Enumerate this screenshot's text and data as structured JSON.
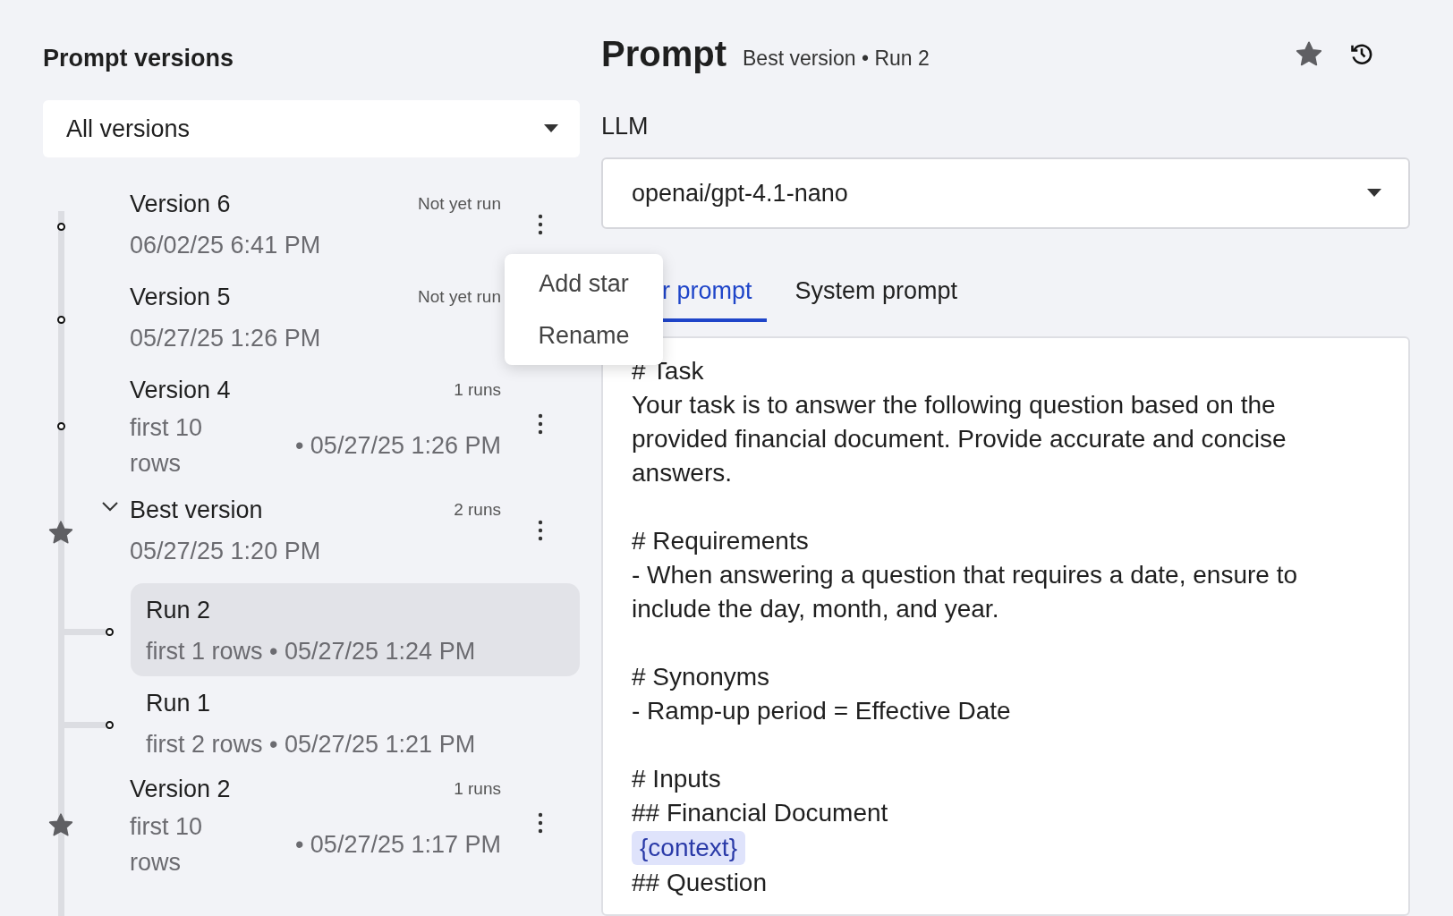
{
  "sidebar": {
    "title": "Prompt versions",
    "filter": {
      "value": "All versions"
    },
    "versions": [
      {
        "title": "Version 6",
        "status": "Not yet run",
        "date": "06/02/25 6:41 PM",
        "starred": false,
        "menu": true
      },
      {
        "title": "Version 5",
        "status": "Not yet run",
        "date": "05/27/25 1:26 PM",
        "starred": false,
        "menu": false
      },
      {
        "title": "Version 4",
        "status": "1 runs",
        "rows": "first 10 rows",
        "date": "• 05/27/25 1:26 PM",
        "starred": false,
        "menu": true
      },
      {
        "title": "Best version",
        "status": "2 runs",
        "date": "05/27/25 1:20 PM",
        "starred": true,
        "menu": true,
        "expanded": true,
        "children": [
          {
            "title": "Run 2",
            "detail": "first 1 rows • 05/27/25 1:24 PM",
            "selected": true
          },
          {
            "title": "Run 1",
            "detail": "first 2 rows • 05/27/25 1:21 PM",
            "selected": false
          }
        ]
      },
      {
        "title": "Version 2",
        "status": "1 runs",
        "rows": "first 10 rows",
        "date": "• 05/27/25 1:17 PM",
        "starred": true,
        "menu": true
      }
    ]
  },
  "context_menu": {
    "items": [
      "Add star",
      "Rename"
    ]
  },
  "header": {
    "title": "Prompt",
    "subtitle": "Best version • Run 2",
    "starred": true
  },
  "llm": {
    "label": "LLM",
    "value": "openai/gpt-4.1-nano"
  },
  "tabs": [
    {
      "label": "r prompt",
      "selected": true
    },
    {
      "label": "System prompt",
      "selected": false
    }
  ],
  "prompt_lines": [
    {
      "kind": "text",
      "text": "# Task"
    },
    {
      "kind": "text",
      "text": "Your task is to answer the following question based on the provided financial document. Provide accurate and concise answers."
    },
    {
      "kind": "blank"
    },
    {
      "kind": "text",
      "text": "# Requirements"
    },
    {
      "kind": "text",
      "text": "- When answering a question that requires a date, ensure to include the day, month, and year."
    },
    {
      "kind": "blank"
    },
    {
      "kind": "text",
      "text": "# Synonyms"
    },
    {
      "kind": "text",
      "text": "- Ramp-up period = Effective Date"
    },
    {
      "kind": "blank"
    },
    {
      "kind": "text",
      "text": "# Inputs"
    },
    {
      "kind": "text",
      "text": "## Financial Document"
    },
    {
      "kind": "variable",
      "text": "{context}"
    },
    {
      "kind": "text",
      "text": "## Question"
    }
  ]
}
